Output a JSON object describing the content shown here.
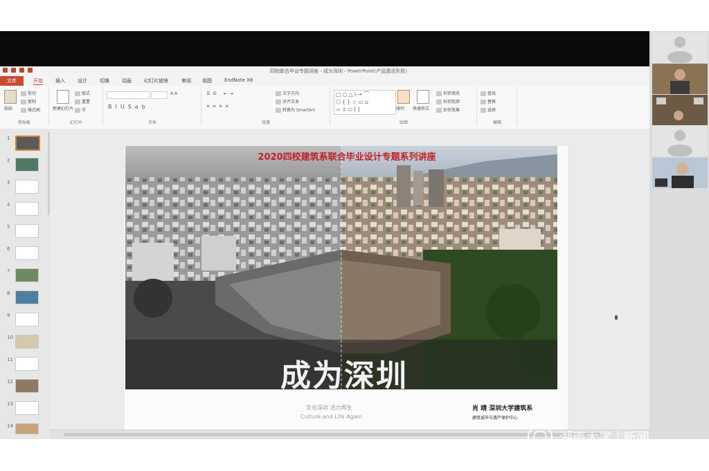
{
  "window": {
    "title": "四校联合毕设专题讲座 - 成为深圳 - PowerPoint(产品激活失败)"
  },
  "ribbon_tabs": [
    "文件",
    "开始",
    "插入",
    "设计",
    "切换",
    "动画",
    "幻灯片放映",
    "审阅",
    "视图",
    "EndNote X8"
  ],
  "ribbon": {
    "clipboard": {
      "paste": "粘贴",
      "cut": "剪切",
      "copy": "复制",
      "format_painter": "格式刷",
      "label": "剪贴板"
    },
    "slides": {
      "new_slide": "新建幻灯片",
      "layout": "版式",
      "reset": "重置",
      "section": "节",
      "label": "幻灯片"
    },
    "font": {
      "label": "字体"
    },
    "paragraph": {
      "text_direction": "文字方向",
      "align_text": "对齐文本",
      "smartart": "转换为 SmartArt",
      "label": "段落"
    },
    "drawing": {
      "arrange": "排列",
      "quick_styles": "快速样式",
      "shape_fill": "形状填充",
      "shape_outline": "形状轮廓",
      "shape_effects": "形状效果",
      "label": "绘图"
    },
    "editing": {
      "find": "查找",
      "replace": "替换",
      "select": "选择",
      "label": "编辑"
    }
  },
  "thumbnails": [
    "1",
    "2",
    "3",
    "4",
    "5",
    "6",
    "7",
    "8",
    "9",
    "10",
    "11",
    "12",
    "13",
    "14"
  ],
  "slide": {
    "title": "2020四校建筑系联合毕业设计专题系列讲座",
    "main_title": "成为深圳",
    "subtitle_cn": "文化深圳 活力再生",
    "subtitle_en": "Culture and Life Again",
    "author": "肖 靖 深圳大学建筑系",
    "org": "建筑城市与遗产保护中心"
  },
  "watermark": {
    "school": "湖南大学",
    "news": "新闻"
  },
  "colors": {
    "accent": "#c84b31",
    "title_red": "#c0202a",
    "selected_thumb": "#d4862f"
  }
}
